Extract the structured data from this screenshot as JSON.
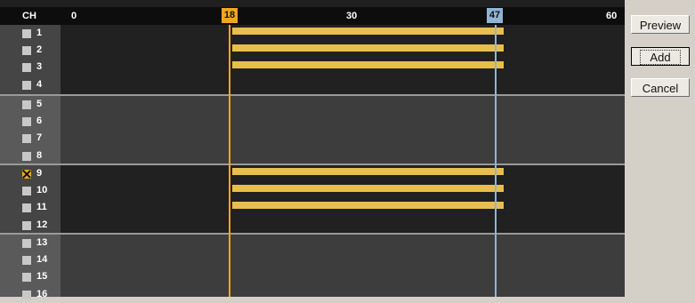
{
  "header": {
    "ch_label": "CH",
    "ticks": [
      "0",
      "30",
      "60"
    ]
  },
  "markers": {
    "start": "18",
    "end": "47"
  },
  "channels": [
    {
      "num": "1",
      "checked": false,
      "recording": true
    },
    {
      "num": "2",
      "checked": false,
      "recording": true
    },
    {
      "num": "3",
      "checked": false,
      "recording": true
    },
    {
      "num": "4",
      "checked": false,
      "recording": false
    },
    {
      "num": "5",
      "checked": false,
      "recording": false
    },
    {
      "num": "6",
      "checked": false,
      "recording": false
    },
    {
      "num": "7",
      "checked": false,
      "recording": false
    },
    {
      "num": "8",
      "checked": false,
      "recording": false
    },
    {
      "num": "9",
      "checked": true,
      "recording": true
    },
    {
      "num": "10",
      "checked": false,
      "recording": true
    },
    {
      "num": "11",
      "checked": false,
      "recording": true
    },
    {
      "num": "12",
      "checked": false,
      "recording": false
    },
    {
      "num": "13",
      "checked": false,
      "recording": false
    },
    {
      "num": "14",
      "checked": false,
      "recording": false
    },
    {
      "num": "15",
      "checked": false,
      "recording": false
    },
    {
      "num": "16",
      "checked": false,
      "recording": false
    }
  ],
  "buttons": {
    "preview": "Preview",
    "add": "Add",
    "cancel": "Cancel"
  },
  "colors": {
    "start_marker": "#f0a81a",
    "end_marker": "#8fb4d6",
    "bar": "#e8bf4c"
  }
}
